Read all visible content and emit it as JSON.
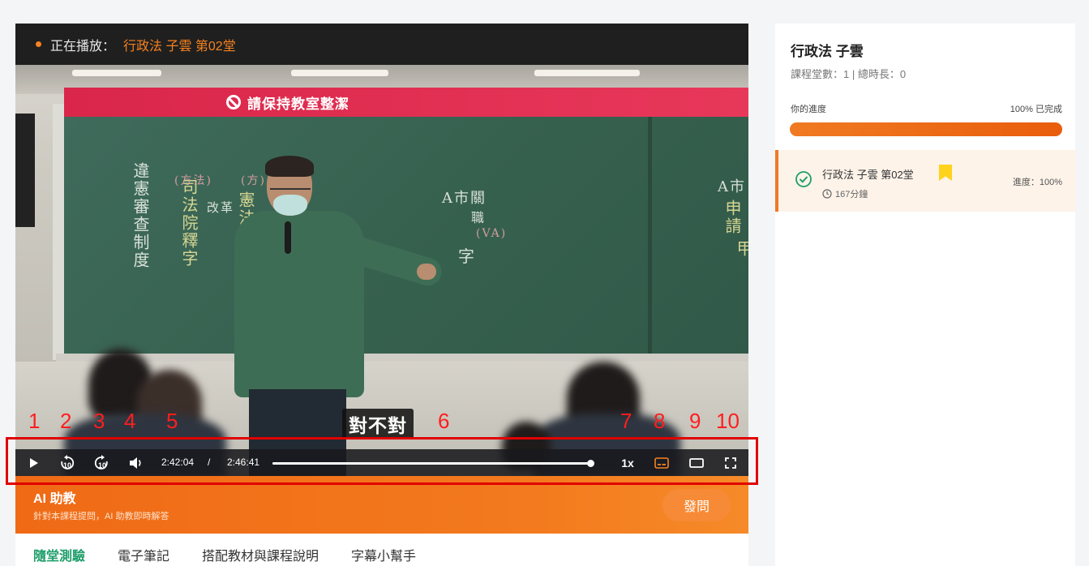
{
  "now_playing": {
    "label": "正在播放：",
    "title": "行政法 子雲 第02堂"
  },
  "video": {
    "banner": "請保持教室整潔",
    "subtitle": "對不對",
    "chalk": [
      "違憲審查制度",
      "司法院釋字",
      "(方法)",
      "(方)",
      "改革",
      "憲法",
      "A市關",
      "職",
      "(VA)",
      "字",
      "A市",
      "申請",
      "甲"
    ],
    "annotations": [
      "1",
      "2",
      "3",
      "4",
      "5",
      "6",
      "7",
      "8",
      "9",
      "10"
    ]
  },
  "controls": {
    "current_time": "2:42:04",
    "separator": "/",
    "duration": "2:46:41",
    "progress_fraction": 0.99,
    "speed": "1x",
    "icons": [
      "play-icon",
      "rewind-10-icon",
      "forward-10-icon",
      "volume-icon",
      "subtitles-icon",
      "theater-mode-icon",
      "fullscreen-icon"
    ],
    "accent_color": "#f58220"
  },
  "ai_assistant": {
    "title": "AI 助教",
    "subtitle": "針對本課程提問，AI 助教即時解答",
    "button": "發問"
  },
  "tabs": [
    "隨堂測驗",
    "電子筆記",
    "搭配教材與課程說明",
    "字幕小幫手"
  ],
  "sidebar": {
    "course_title": "行政法 子雲",
    "meta": "課程堂數：1 | 總時長：0",
    "progress_label": "你的進度",
    "progress_value": "100% 已完成",
    "progress_fraction": 1.0,
    "lessons": [
      {
        "name": "行政法 子雲 第02堂",
        "duration": "167分鐘",
        "progress": "進度：100%",
        "bookmarked": true,
        "completed": true
      }
    ]
  }
}
